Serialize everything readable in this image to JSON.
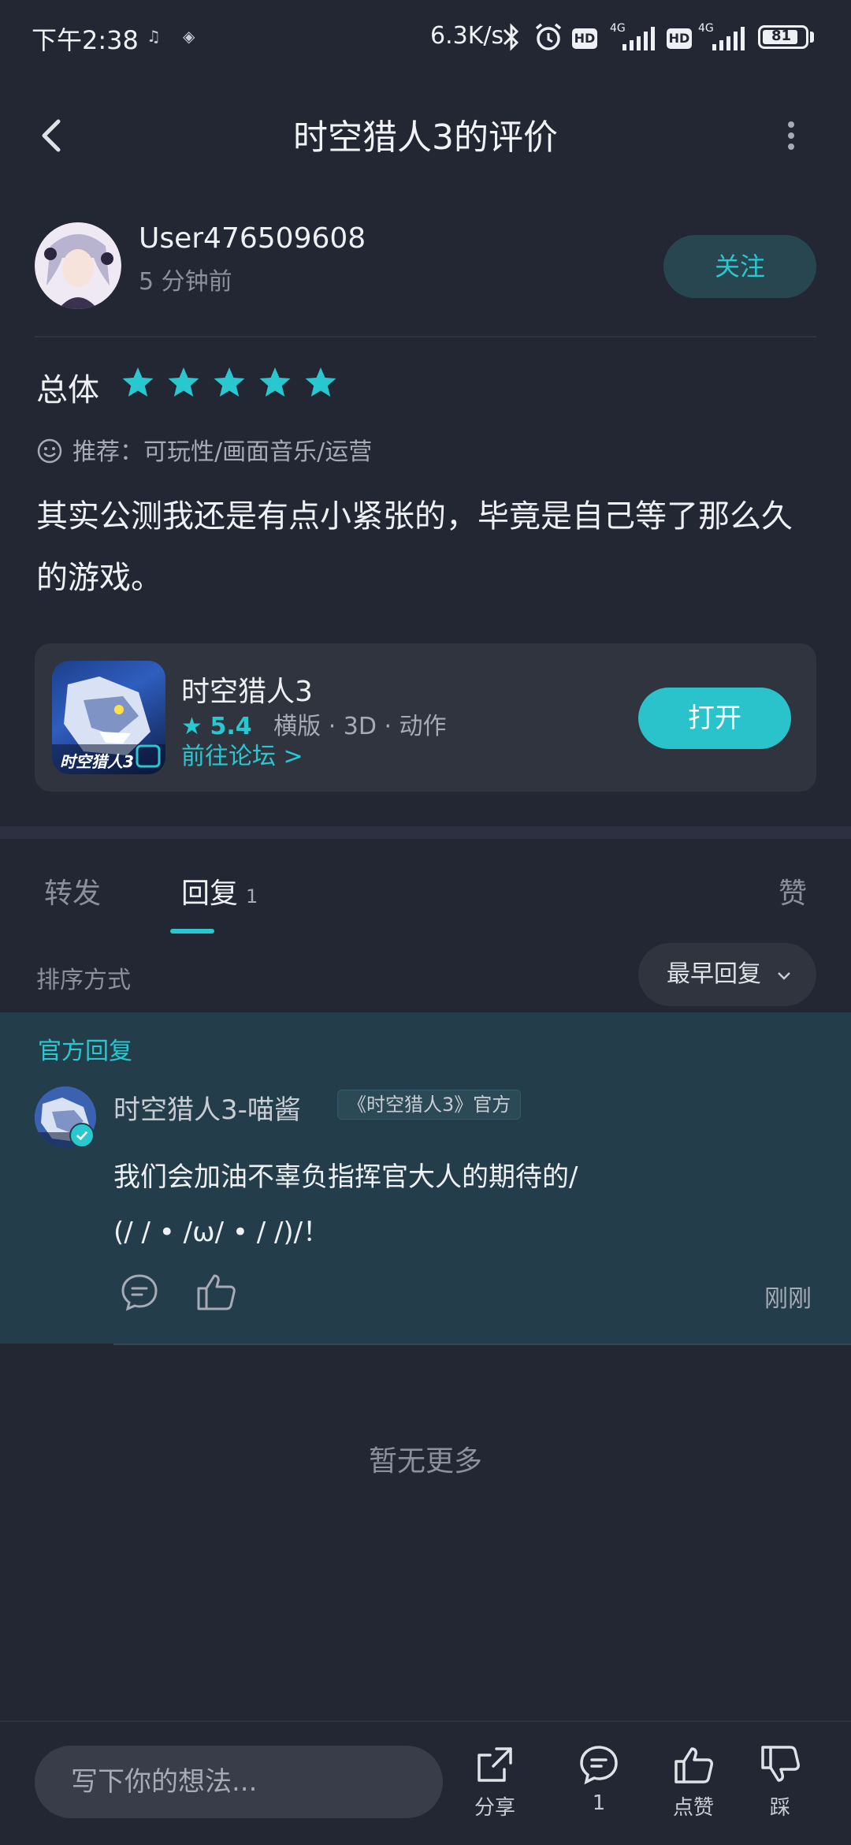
{
  "status_bar": {
    "time": "下午2:38",
    "net_speed": "6.3K/s",
    "icon_hd": "HD",
    "icon_4g": "4G",
    "battery": "81"
  },
  "header": {
    "title": "时空猎人3的评价"
  },
  "user": {
    "name": "User476509608",
    "time_ago": "5 分钟前",
    "follow_label": "关注"
  },
  "rating": {
    "label": "总体",
    "stars": 5,
    "recommend": "推荐：可玩性/画面音乐/运营"
  },
  "review": {
    "text": "其实公测我还是有点小紧张的，毕竟是自己等了那么久的游戏。"
  },
  "game": {
    "name": "时空猎人3",
    "score": "5.4",
    "tags": "横版 · 3D · 动作",
    "forum_link": "前往论坛 >",
    "open_label": "打开",
    "icon_text": "时空猎人3"
  },
  "tabs": {
    "forward": "转发",
    "reply": "回复",
    "reply_count": "1",
    "like": "赞"
  },
  "sort": {
    "label": "排序方式",
    "selected": "最早回复"
  },
  "official_reply": {
    "section_label": "官方回复",
    "author": "时空猎人3-喵酱",
    "tag": "《时空猎人3》官方",
    "text": "我们会加油不辜负指挥官大人的期待的/\n(/ / • /ω/ • / /)/！",
    "time": "刚刚"
  },
  "no_more": "暂无更多",
  "bottom_bar": {
    "input_placeholder": "写下你的想法...",
    "share_label": "分享",
    "comment_count": "1",
    "like_label": "点赞",
    "dislike_label": "踩"
  },
  "colors": {
    "background": "#232633",
    "accent": "#29c7cf",
    "reply_bg": "#233e4a",
    "card_bg": "#30343f"
  }
}
